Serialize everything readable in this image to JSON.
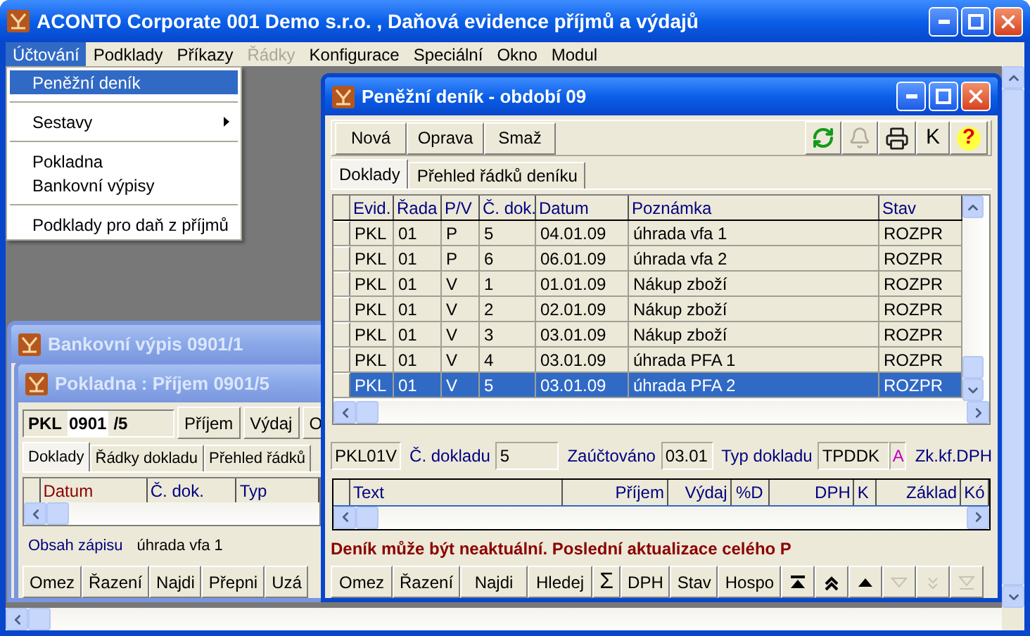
{
  "window": {
    "title": "ACONTO Corporate 001 Demo s.r.o. , Daňová evidence příjmů a výdajů",
    "active": true
  },
  "menu_bar": [
    {
      "label": "Účtování",
      "selected": true,
      "disabled": false
    },
    {
      "label": "Podklady",
      "selected": false,
      "disabled": false
    },
    {
      "label": "Příkazy",
      "selected": false,
      "disabled": false
    },
    {
      "label": "Řádky",
      "selected": false,
      "disabled": true
    },
    {
      "label": "Konfigurace",
      "selected": false,
      "disabled": false
    },
    {
      "label": "Speciální",
      "selected": false,
      "disabled": false
    },
    {
      "label": "Okno",
      "selected": false,
      "disabled": false
    },
    {
      "label": "Modul",
      "selected": false,
      "disabled": false
    }
  ],
  "menu_dropdown": [
    {
      "kind": "item",
      "label": "Peněžní deník",
      "selected": true
    },
    {
      "kind": "separator"
    },
    {
      "kind": "submenu",
      "label": "Sestavy",
      "selected": false
    },
    {
      "kind": "separator"
    },
    {
      "kind": "item",
      "label": "Pokladna",
      "selected": false
    },
    {
      "kind": "item",
      "label": "Bankovní výpisy",
      "selected": false
    },
    {
      "kind": "separator"
    },
    {
      "kind": "item",
      "label": "Podklady pro daň z příjmů",
      "selected": false
    }
  ],
  "bank_window": {
    "title": "Bankovní výpis 0901/1",
    "active": false
  },
  "cash_window": {
    "title": "Pokladna : Příjem 0901/5",
    "active": false,
    "doc_prefix": "PKL",
    "doc_number": "0901",
    "doc_suffix": "/5",
    "buttons": [
      "Příjem",
      "Výdaj",
      "O"
    ],
    "tabs": [
      {
        "label": "Doklady",
        "selected": true
      },
      {
        "label": "Řádky dokladu",
        "selected": false
      },
      {
        "label": "Přehled řádků",
        "selected": false
      }
    ],
    "columns": [
      {
        "label": "Datum",
        "color": "#8b0000"
      },
      {
        "label": "Č. dok.",
        "color": "#000080"
      },
      {
        "label": "Typ",
        "color": "#000080"
      }
    ],
    "content_label": "Obsah zápisu",
    "content_value": "úhrada vfa 1",
    "bottom_buttons": [
      "Omez",
      "Řazení",
      "Najdi",
      "Přepni",
      "Uzá"
    ]
  },
  "journal_window": {
    "title": "Peněžní deník - období 09",
    "active": true,
    "buttons": [
      "Nová",
      "Oprava",
      "Smaž"
    ],
    "tools": [
      {
        "kind": "refresh",
        "disabled": false
      },
      {
        "kind": "bell",
        "disabled": true
      },
      {
        "kind": "print",
        "disabled": false
      },
      {
        "kind": "text",
        "label": "K",
        "disabled": false
      },
      {
        "kind": "help",
        "label": "?",
        "disabled": false
      }
    ],
    "tabs": [
      {
        "label": "Doklady",
        "selected": true
      },
      {
        "label": "Přehled řádků deníku",
        "selected": false
      }
    ],
    "columns": [
      "Evid.",
      "Řada",
      "P/V",
      "Č. dok.",
      "Datum",
      "Poznámka",
      "Stav"
    ],
    "rows": [
      {
        "cells": [
          "PKL",
          "01",
          "P",
          "5",
          "04.01.09",
          "úhrada vfa 1",
          "ROZPR"
        ],
        "selected": false
      },
      {
        "cells": [
          "PKL",
          "01",
          "P",
          "6",
          "06.01.09",
          "úhrada vfa 2",
          "ROZPR"
        ],
        "selected": false
      },
      {
        "cells": [
          "PKL",
          "01",
          "V",
          "1",
          "01.01.09",
          "Nákup zboží",
          "ROZPR"
        ],
        "selected": false
      },
      {
        "cells": [
          "PKL",
          "01",
          "V",
          "2",
          "02.01.09",
          "Nákup zboží",
          "ROZPR"
        ],
        "selected": false
      },
      {
        "cells": [
          "PKL",
          "01",
          "V",
          "3",
          "03.01.09",
          "Nákup zboží",
          "ROZPR"
        ],
        "selected": false
      },
      {
        "cells": [
          "PKL",
          "01",
          "V",
          "4",
          "03.01.09",
          "úhrada PFA 1",
          "ROZPR"
        ],
        "selected": false
      },
      {
        "cells": [
          "PKL",
          "01",
          "V",
          "5",
          "03.01.09",
          "úhrada PFA 2",
          "ROZPR"
        ],
        "selected": true
      }
    ],
    "info": [
      {
        "kind": "field",
        "value": "PKL01V"
      },
      {
        "kind": "label",
        "text": "Č. dokladu"
      },
      {
        "kind": "field",
        "value": "5"
      },
      {
        "kind": "label",
        "text": "Zaúčtováno"
      },
      {
        "kind": "field",
        "value": "03.01"
      },
      {
        "kind": "label",
        "text": "Typ dokladu"
      },
      {
        "kind": "field",
        "value": "TPDDK"
      },
      {
        "kind": "flag",
        "value": "A"
      },
      {
        "kind": "label",
        "text": "Zk.kf.DPH"
      }
    ],
    "line_columns": [
      "Text",
      "Příjem",
      "Výdaj",
      "%D",
      "DPH",
      "K",
      "Základ",
      "Kó"
    ],
    "message": "Deník může být neaktuální. Poslední aktualizace celého P",
    "bottom_buttons": [
      "Omez",
      "Řazení",
      "Najdi",
      "Hledej",
      "Σ",
      "DPH",
      "Stav",
      "Hospo"
    ],
    "nav_buttons": [
      {
        "kind": "first",
        "disabled": false
      },
      {
        "kind": "page_up",
        "disabled": false
      },
      {
        "kind": "up",
        "disabled": false
      },
      {
        "kind": "down",
        "disabled": true
      },
      {
        "kind": "page_down",
        "disabled": true
      },
      {
        "kind": "last",
        "disabled": true
      }
    ]
  }
}
